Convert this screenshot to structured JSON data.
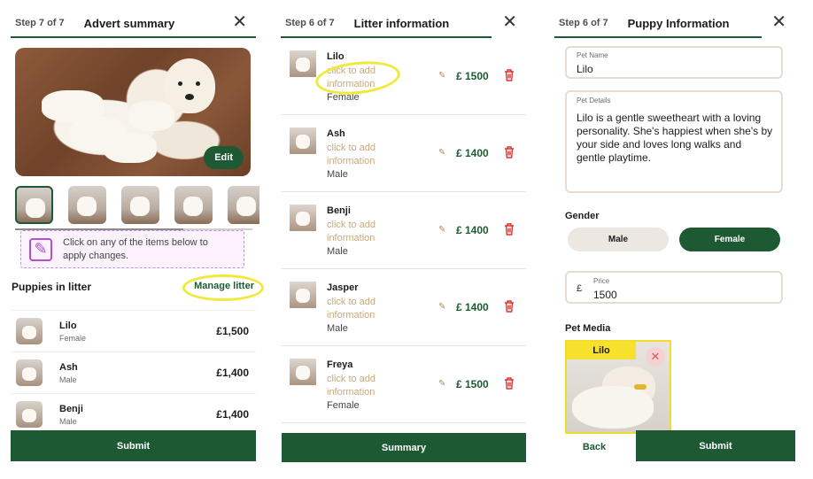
{
  "panel1": {
    "step": "Step 7 of 7",
    "title": "Advert summary",
    "close_icon": "close-icon",
    "edit_label": "Edit",
    "notice_text": "Click on any of the items below to apply changes.",
    "litter_title": "Puppies in litter",
    "manage_litter_label": "Manage litter",
    "puppies": [
      {
        "name": "Lilo",
        "sex": "Female",
        "price": "£1,500"
      },
      {
        "name": "Ash",
        "sex": "Male",
        "price": "£1,400"
      },
      {
        "name": "Benji",
        "sex": "Male",
        "price": "£1,400"
      }
    ],
    "submit_label": "Submit"
  },
  "panel2": {
    "step": "Step 6 of 7",
    "title": "Litter information",
    "placeholder": "click to add information",
    "puppies": [
      {
        "name": "Lilo",
        "sex": "Female",
        "price": "£ 1500"
      },
      {
        "name": "Ash",
        "sex": "Male",
        "price": "£ 1400"
      },
      {
        "name": "Benji",
        "sex": "Male",
        "price": "£ 1400"
      },
      {
        "name": "Jasper",
        "sex": "Male",
        "price": "£ 1400"
      },
      {
        "name": "Freya",
        "sex": "Female",
        "price": "£ 1500"
      }
    ],
    "summary_label": "Summary"
  },
  "panel3": {
    "step": "Step 6 of 7",
    "title": "Puppy Information",
    "pet_name_label": "Pet Name",
    "pet_name_value": "Lilo",
    "pet_details_label": "Pet Details",
    "pet_details_value": "Lilo is a gentle sweetheart with a loving personality. She's happiest when she's by your side and loves long walks and gentle playtime.",
    "gender_label": "Gender",
    "gender_options": [
      "Male",
      "Female"
    ],
    "gender_selected": "Female",
    "currency_symbol": "£",
    "price_label": "Price",
    "price_value": "1500",
    "pet_media_label": "Pet Media",
    "media_tag": "Lilo",
    "back_label": "Back",
    "submit_label": "Submit"
  },
  "colors": {
    "brand_green": "#1d5a33",
    "highlight_yellow": "#f0e93a",
    "placeholder_tan": "#c9a87e",
    "delete_red": "#d9352f"
  }
}
